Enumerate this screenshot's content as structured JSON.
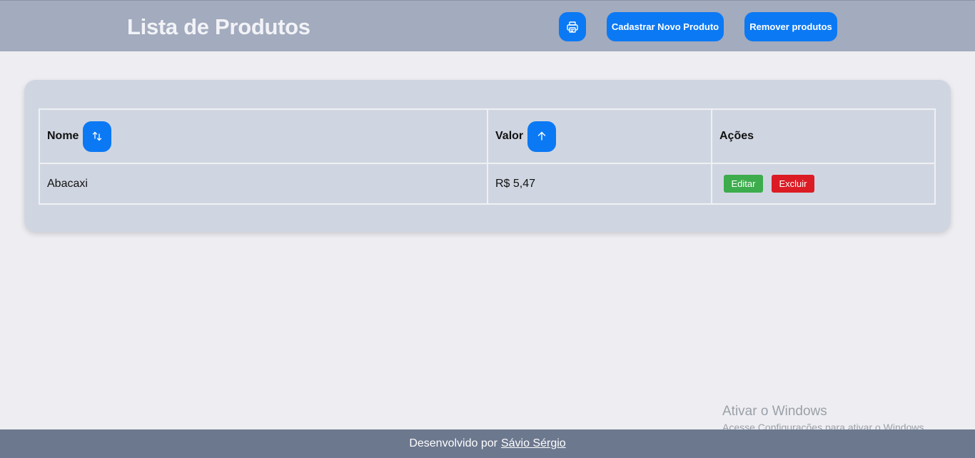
{
  "header": {
    "title": "Lista de Produtos",
    "print_icon": "printer-icon",
    "new_product_label": "Cadastrar Novo Produto",
    "remove_products_label": "Remover produtos"
  },
  "table": {
    "columns": [
      {
        "label": "Nome",
        "sort_icon": "sort-up-down-icon"
      },
      {
        "label": "Valor",
        "sort_icon": "arrow-up-icon"
      },
      {
        "label": "Ações"
      }
    ],
    "rows": [
      {
        "nome": "Abacaxi",
        "valor": "R$ 5,47",
        "edit_label": "Editar",
        "delete_label": "Excluir"
      }
    ]
  },
  "watermark": {
    "title": "Ativar o Windows",
    "subtitle": "Acesse Configurações para ativar o Windows."
  },
  "footer": {
    "prefix": "Desenvolvido por",
    "author": "Sávio Sérgio"
  },
  "colors": {
    "accent": "#0b79f4",
    "header_bg": "#a3abbe",
    "footer_bg": "#6c788e",
    "edit": "#3cac4c",
    "delete": "#dc1c24"
  }
}
